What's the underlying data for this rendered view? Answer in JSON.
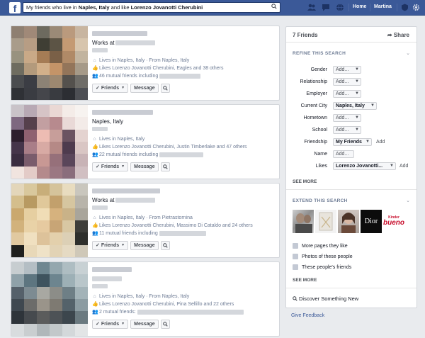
{
  "topbar": {
    "logo": "f",
    "search_prefix": "My friends who live in ",
    "search_city": "Naples, Italy",
    "search_mid": " and like ",
    "search_like": "Lorenzo Jovanotti Cherubini",
    "nav": [
      "Home",
      "Martina"
    ],
    "icons": [
      "friend-requests-icon",
      "messages-icon",
      "notifications-icon",
      "privacy-icon",
      "settings-gear-icon"
    ]
  },
  "results": [
    {
      "title": "Works at",
      "line1": "Lives in Naples, Italy · From Naples, Italy",
      "line2": "Likes Lorenzo Jovanotti Cherubini, Eagles and 38 others",
      "line3": "46 mutual friends including",
      "friends_btn": "Friends",
      "message_btn": "Message"
    },
    {
      "title": "Naples, Italy",
      "line1": "Lives in Naples, Italy",
      "line2": "Likes Lorenzo Jovanotti Cherubini, Justin Timberlake and 47 others",
      "line3": "22 mutual friends including",
      "friends_btn": "Friends",
      "message_btn": "Message"
    },
    {
      "title": "Works at",
      "line1": "Lives in Naples, Italy · From Pietrastornina",
      "line2": "Likes Lorenzo Jovanotti Cherubini, Massimo Di Cataldo and 24 others",
      "line3": "11 mutual friends including",
      "friends_btn": "Friends",
      "message_btn": "Message"
    },
    {
      "title": "",
      "line1": "Lives in Naples, Italy · From Naples, Italy",
      "line2": "Likes Lorenzo Jovanotti Cherubini, Pina Sellillo and 22 others",
      "line3": "2 mutual friends:",
      "friends_btn": "Friends",
      "message_btn": "Message"
    }
  ],
  "sidebar": {
    "count": "7 Friends",
    "share": "Share",
    "refine_title": "REFINE THIS SEARCH",
    "filters": [
      {
        "label": "Gender",
        "value": "Add..."
      },
      {
        "label": "Relationship",
        "value": "Add..."
      },
      {
        "label": "Employer",
        "value": "Add..."
      },
      {
        "label": "Current City",
        "value": "Naples, Italy"
      },
      {
        "label": "Hometown",
        "value": "Add..."
      },
      {
        "label": "School",
        "value": "Add..."
      },
      {
        "label": "Friendship",
        "value": "My Friends",
        "add": "Add"
      },
      {
        "label": "Name",
        "value": "Add..."
      },
      {
        "label": "Likes",
        "value": "Lorenzo Jovanotti...",
        "add": "Add"
      }
    ],
    "see_more": "SEE MORE",
    "extend_title": "EXTEND THIS SEARCH",
    "brand_dior": "Dior",
    "brand_bueno_top": "Kinder",
    "brand_bueno": "bueno",
    "links": [
      "More pages they like",
      "Photos of these people",
      "These people's friends"
    ],
    "see_more2": "SEE MORE",
    "discover": "Discover Something New"
  },
  "footer": {
    "feedback": "Give Feedback"
  },
  "colors": {
    "brand": "#3b5998",
    "page_bg": "#e9ebee"
  }
}
